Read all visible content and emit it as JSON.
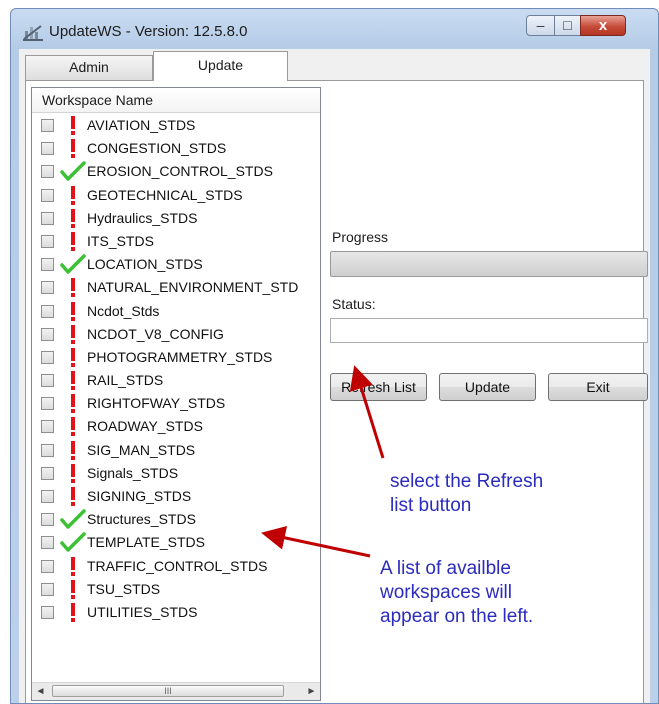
{
  "window": {
    "title": "UpdateWS - Version: 12.5.8.0",
    "icon": "app-icon"
  },
  "title_buttons": {
    "minimize": "–",
    "maximize": "□",
    "close": "x"
  },
  "tabs": [
    {
      "label": "Admin",
      "selected": false
    },
    {
      "label": "Update",
      "selected": true
    }
  ],
  "list": {
    "header": "Workspace Name",
    "items": [
      {
        "name": "AVIATION_STDS",
        "status": "exclamation"
      },
      {
        "name": "CONGESTION_STDS",
        "status": "exclamation"
      },
      {
        "name": "EROSION_CONTROL_STDS",
        "status": "check"
      },
      {
        "name": "GEOTECHNICAL_STDS",
        "status": "exclamation"
      },
      {
        "name": "Hydraulics_STDS",
        "status": "exclamation"
      },
      {
        "name": "ITS_STDS",
        "status": "exclamation"
      },
      {
        "name": "LOCATION_STDS",
        "status": "check"
      },
      {
        "name": "NATURAL_ENVIRONMENT_STD",
        "status": "exclamation"
      },
      {
        "name": "Ncdot_Stds",
        "status": "exclamation"
      },
      {
        "name": "NCDOT_V8_CONFIG",
        "status": "exclamation"
      },
      {
        "name": "PHOTOGRAMMETRY_STDS",
        "status": "exclamation"
      },
      {
        "name": "RAIL_STDS",
        "status": "exclamation"
      },
      {
        "name": "RIGHTOFWAY_STDS",
        "status": "exclamation"
      },
      {
        "name": "ROADWAY_STDS",
        "status": "exclamation"
      },
      {
        "name": "SIG_MAN_STDS",
        "status": "exclamation"
      },
      {
        "name": "Signals_STDS",
        "status": "exclamation"
      },
      {
        "name": "SIGNING_STDS",
        "status": "exclamation"
      },
      {
        "name": "Structures_STDS",
        "status": "check"
      },
      {
        "name": "TEMPLATE_STDS",
        "status": "check"
      },
      {
        "name": "TRAFFIC_CONTROL_STDS",
        "status": "exclamation"
      },
      {
        "name": "TSU_STDS",
        "status": "exclamation"
      },
      {
        "name": "UTILITIES_STDS",
        "status": "exclamation"
      }
    ],
    "scroll_left": "◄",
    "scroll_right": "►",
    "scroll_thumb": "III"
  },
  "progress": {
    "label": "Progress",
    "value": 0
  },
  "status": {
    "label": "Status:",
    "value": ""
  },
  "buttons": {
    "refresh": "Refresh List",
    "update": "Update",
    "exit": "Exit"
  },
  "annotations": {
    "refresh_note": [
      "select the Refresh",
      "list button"
    ],
    "list_note": [
      "A list of availble",
      "workspaces will",
      "appear on the left."
    ]
  },
  "colors": {
    "exclamation": "#e3111a",
    "check": "#3cc034",
    "arrow": "#c00000",
    "annotation_text": "#2b2bbf"
  }
}
